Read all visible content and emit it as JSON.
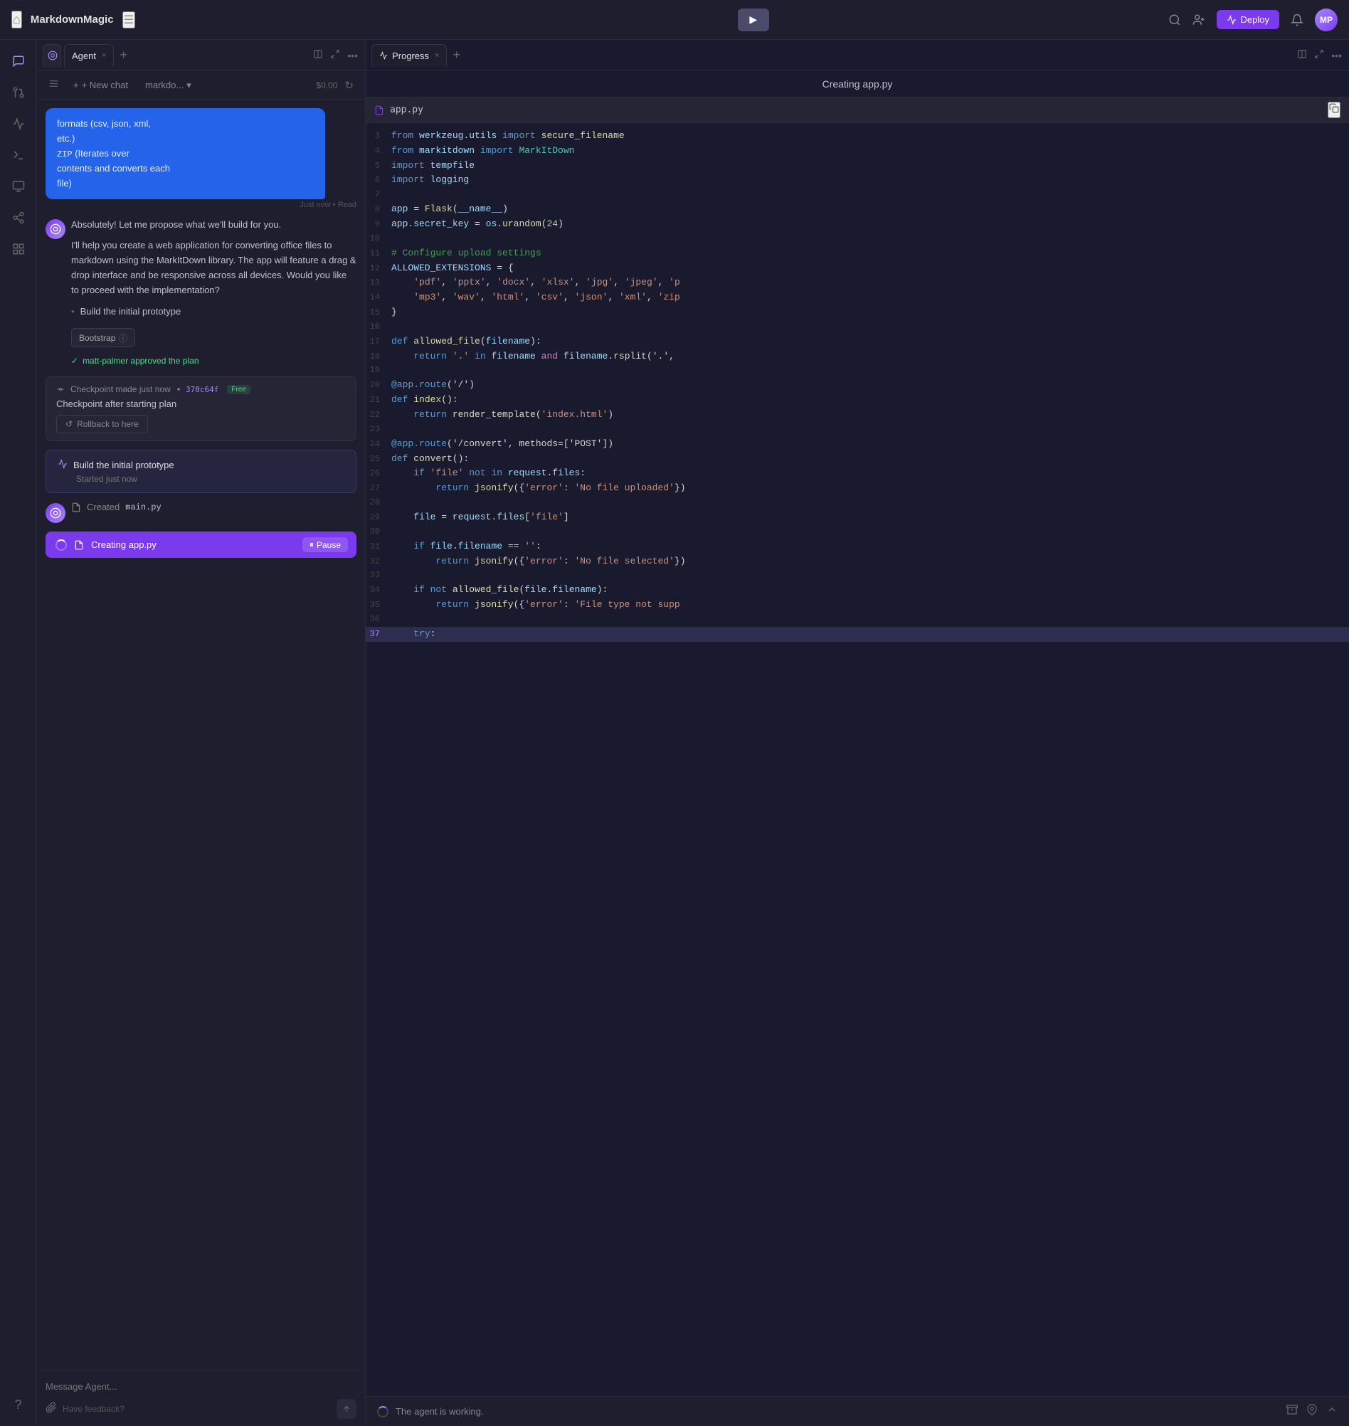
{
  "app": {
    "title": "MarkdownMagic",
    "home_icon": "⌂",
    "layout_icon": "☰"
  },
  "header": {
    "play_label": "▶",
    "deploy_label": "Deploy",
    "search_icon": "🔍",
    "add_user_icon": "👤+",
    "bell_icon": "🔔",
    "avatar_initials": "MP"
  },
  "left_sidebar": {
    "icons": [
      {
        "name": "chat-icon",
        "symbol": "💬",
        "active": true
      },
      {
        "name": "git-icon",
        "symbol": "◉"
      },
      {
        "name": "terminal-icon",
        "symbol": ">_"
      },
      {
        "name": "monitor-icon",
        "symbol": "⬜"
      },
      {
        "name": "branch-icon",
        "symbol": "⎇"
      },
      {
        "name": "grid-icon",
        "symbol": "⊞"
      }
    ],
    "bottom_icon": {
      "name": "help-icon",
      "symbol": "?"
    }
  },
  "agent_panel": {
    "tab_label": "Agent",
    "tab_close": "×",
    "tab_add": "+",
    "new_chat_label": "+ New chat",
    "chat_selector_label": "markdo...",
    "chat_selector_icon": "▾",
    "cost_label": "$0.00",
    "refresh_icon": "↻"
  },
  "progress_panel": {
    "tab_label": "Progress",
    "tab_close": "×",
    "tab_add": "+"
  },
  "messages": [
    {
      "type": "user",
      "content": "formats (csv, json, xml, etc.)\nZIP (Iterates over contents and converts each file)",
      "timestamp": "Just now • Read"
    },
    {
      "type": "agent",
      "content_lines": [
        "Absolutely! Let me propose what we'll build for you.",
        "I'll help you create a web application for converting office files to markdown using the MarkItDown library. The app will feature a drag & drop interface and be responsive across all devices. Would you like to proceed with the implementation?"
      ],
      "plan_item": "Build the initial prototype",
      "badge_label": "Bootstrap",
      "approval": "matt-palmer approved the plan"
    },
    {
      "type": "checkpoint",
      "header": "Checkpoint made just now",
      "hash": "370c64f",
      "free_label": "Free",
      "title": "Checkpoint after starting plan",
      "rollback_label": "Rollback to here"
    },
    {
      "type": "task",
      "title": "Build the initial prototype",
      "subtitle": "Started just now"
    },
    {
      "type": "agent_action",
      "content": "Created main.py",
      "file": "main.py"
    }
  ],
  "progress_bar": {
    "label": "Creating app.py",
    "pause_label": "Pause",
    "pause_icon": "⏸"
  },
  "chat_input": {
    "placeholder": "Message Agent...",
    "feedback_text": "Have feedback?",
    "attach_icon": "📎",
    "send_icon": "↑"
  },
  "editor": {
    "title": "Creating app.py",
    "filename": "app.py",
    "lines": [
      {
        "num": 3,
        "tokens": [
          {
            "t": "kw",
            "v": "from "
          },
          {
            "t": "var",
            "v": "werkzeug.utils "
          },
          {
            "t": "kw",
            "v": "import "
          },
          {
            "t": "fn",
            "v": "secure_filename"
          }
        ]
      },
      {
        "num": 4,
        "tokens": [
          {
            "t": "kw",
            "v": "from "
          },
          {
            "t": "var",
            "v": "markitdown "
          },
          {
            "t": "kw",
            "v": "import "
          },
          {
            "t": "cls",
            "v": "MarkItDown"
          }
        ]
      },
      {
        "num": 5,
        "tokens": [
          {
            "t": "kw",
            "v": "import "
          },
          {
            "t": "var",
            "v": "tempfile"
          }
        ]
      },
      {
        "num": 6,
        "tokens": [
          {
            "t": "kw",
            "v": "import "
          },
          {
            "t": "var",
            "v": "logging"
          }
        ]
      },
      {
        "num": 7,
        "tokens": []
      },
      {
        "num": 8,
        "tokens": [
          {
            "t": "var",
            "v": "app "
          },
          {
            "t": "punc",
            "v": "= "
          },
          {
            "t": "fn",
            "v": "Flask"
          },
          {
            "t": "punc",
            "v": "("
          },
          {
            "t": "var",
            "v": "__name__"
          },
          {
            "t": "punc",
            "v": ")"
          }
        ]
      },
      {
        "num": 9,
        "tokens": [
          {
            "t": "var",
            "v": "app"
          },
          {
            "t": "punc",
            "v": "."
          },
          {
            "t": "var",
            "v": "secret_key "
          },
          {
            "t": "punc",
            "v": "= "
          },
          {
            "t": "var",
            "v": "os"
          },
          {
            "t": "punc",
            "v": "."
          },
          {
            "t": "fn",
            "v": "urandom"
          },
          {
            "t": "punc",
            "v": "("
          },
          {
            "t": "num",
            "v": "24"
          },
          {
            "t": "punc",
            "v": ")"
          }
        ]
      },
      {
        "num": 10,
        "tokens": []
      },
      {
        "num": 11,
        "tokens": [
          {
            "t": "cmt",
            "v": "# Configure upload settings"
          }
        ]
      },
      {
        "num": 12,
        "tokens": [
          {
            "t": "var",
            "v": "ALLOWED_EXTENSIONS "
          },
          {
            "t": "punc",
            "v": "= {"
          }
        ]
      },
      {
        "num": 13,
        "tokens": [
          {
            "t": "code",
            "v": "    "
          },
          {
            "t": "str",
            "v": "'pdf'"
          },
          {
            "t": "punc",
            "v": ", "
          },
          {
            "t": "str",
            "v": "'pptx'"
          },
          {
            "t": "punc",
            "v": ", "
          },
          {
            "t": "str",
            "v": "'docx'"
          },
          {
            "t": "punc",
            "v": ", "
          },
          {
            "t": "str",
            "v": "'xlsx'"
          },
          {
            "t": "punc",
            "v": ", "
          },
          {
            "t": "str",
            "v": "'jpg'"
          },
          {
            "t": "punc",
            "v": ", "
          },
          {
            "t": "str",
            "v": "'jpeg'"
          },
          {
            "t": "punc",
            "v": ", "
          },
          {
            "t": "str",
            "v": "'p"
          }
        ]
      },
      {
        "num": 14,
        "tokens": [
          {
            "t": "code",
            "v": "    "
          },
          {
            "t": "str",
            "v": "'mp3'"
          },
          {
            "t": "punc",
            "v": ", "
          },
          {
            "t": "str",
            "v": "'wav'"
          },
          {
            "t": "punc",
            "v": ", "
          },
          {
            "t": "str",
            "v": "'html'"
          },
          {
            "t": "punc",
            "v": ", "
          },
          {
            "t": "str",
            "v": "'csv'"
          },
          {
            "t": "punc",
            "v": ", "
          },
          {
            "t": "str",
            "v": "'json'"
          },
          {
            "t": "punc",
            "v": ", "
          },
          {
            "t": "str",
            "v": "'xml'"
          },
          {
            "t": "punc",
            "v": ", "
          },
          {
            "t": "str",
            "v": "'zip"
          }
        ]
      },
      {
        "num": 15,
        "tokens": [
          {
            "t": "punc",
            "v": "}"
          }
        ]
      },
      {
        "num": 16,
        "tokens": []
      },
      {
        "num": 17,
        "tokens": [
          {
            "t": "kw",
            "v": "def "
          },
          {
            "t": "fn",
            "v": "allowed_file"
          },
          {
            "t": "punc",
            "v": "("
          },
          {
            "t": "var",
            "v": "filename"
          },
          {
            "t": "punc",
            "v": "):"
          }
        ]
      },
      {
        "num": 18,
        "tokens": [
          {
            "t": "code",
            "v": "    "
          },
          {
            "t": "kw",
            "v": "return "
          },
          {
            "t": "str",
            "v": "'.' "
          },
          {
            "t": "kw",
            "v": "in "
          },
          {
            "t": "var",
            "v": "filename "
          },
          {
            "t": "kw2",
            "v": "and "
          },
          {
            "t": "var",
            "v": "filename"
          },
          {
            "t": "punc",
            "v": "."
          },
          {
            "t": "fn",
            "v": "rsplit"
          },
          {
            "t": "punc",
            "v": "('.', "
          }
        ]
      },
      {
        "num": 19,
        "tokens": []
      },
      {
        "num": 20,
        "tokens": [
          {
            "t": "decorator",
            "v": "@app.route"
          },
          {
            "t": "punc",
            "v": "('/')"
          }
        ]
      },
      {
        "num": 21,
        "tokens": [
          {
            "t": "kw",
            "v": "def "
          },
          {
            "t": "fn",
            "v": "index"
          },
          {
            "t": "punc",
            "v": "():"
          }
        ]
      },
      {
        "num": 22,
        "tokens": [
          {
            "t": "code",
            "v": "    "
          },
          {
            "t": "kw",
            "v": "return "
          },
          {
            "t": "fn",
            "v": "render_template"
          },
          {
            "t": "punc",
            "v": "("
          },
          {
            "t": "str",
            "v": "'index.html'"
          },
          {
            "t": "punc",
            "v": ")"
          }
        ]
      },
      {
        "num": 23,
        "tokens": []
      },
      {
        "num": 24,
        "tokens": [
          {
            "t": "decorator",
            "v": "@app.route"
          },
          {
            "t": "punc",
            "v": "('/convert', methods=['POST'])"
          }
        ]
      },
      {
        "num": 25,
        "tokens": [
          {
            "t": "kw",
            "v": "def "
          },
          {
            "t": "fn",
            "v": "convert"
          },
          {
            "t": "punc",
            "v": "():"
          }
        ]
      },
      {
        "num": 26,
        "tokens": [
          {
            "t": "code",
            "v": "    "
          },
          {
            "t": "kw",
            "v": "if "
          },
          {
            "t": "str",
            "v": "'file' "
          },
          {
            "t": "kw",
            "v": "not in "
          },
          {
            "t": "var",
            "v": "request"
          },
          {
            "t": "punc",
            "v": "."
          },
          {
            "t": "var",
            "v": "files:"
          }
        ]
      },
      {
        "num": 27,
        "tokens": [
          {
            "t": "code",
            "v": "        "
          },
          {
            "t": "kw",
            "v": "return "
          },
          {
            "t": "fn",
            "v": "jsonify"
          },
          {
            "t": "punc",
            "v": "({"
          },
          {
            "t": "str",
            "v": "'error'"
          },
          {
            "t": "punc",
            "v": ": "
          },
          {
            "t": "str",
            "v": "'No file uploaded'"
          },
          {
            "t": "punc",
            "v": "})"
          }
        ]
      },
      {
        "num": 28,
        "tokens": []
      },
      {
        "num": 29,
        "tokens": [
          {
            "t": "code",
            "v": "    "
          },
          {
            "t": "var",
            "v": "file "
          },
          {
            "t": "punc",
            "v": "= "
          },
          {
            "t": "var",
            "v": "request"
          },
          {
            "t": "punc",
            "v": "."
          },
          {
            "t": "var",
            "v": "files"
          },
          {
            "t": "punc",
            "v": "["
          },
          {
            "t": "str",
            "v": "'file'"
          },
          {
            "t": "punc",
            "v": "]"
          }
        ]
      },
      {
        "num": 30,
        "tokens": []
      },
      {
        "num": 31,
        "tokens": [
          {
            "t": "code",
            "v": "    "
          },
          {
            "t": "kw",
            "v": "if "
          },
          {
            "t": "var",
            "v": "file"
          },
          {
            "t": "punc",
            "v": "."
          },
          {
            "t": "var",
            "v": "filename "
          },
          {
            "t": "punc",
            "v": "== "
          },
          {
            "t": "str",
            "v": "''"
          },
          {
            "t": "punc",
            "v": ":"
          }
        ]
      },
      {
        "num": 32,
        "tokens": [
          {
            "t": "code",
            "v": "        "
          },
          {
            "t": "kw",
            "v": "return "
          },
          {
            "t": "fn",
            "v": "jsonify"
          },
          {
            "t": "punc",
            "v": "({"
          },
          {
            "t": "str",
            "v": "'error'"
          },
          {
            "t": "punc",
            "v": ": "
          },
          {
            "t": "str",
            "v": "'No file selected'"
          },
          {
            "t": "punc",
            "v": "})"
          }
        ]
      },
      {
        "num": 33,
        "tokens": []
      },
      {
        "num": 34,
        "tokens": [
          {
            "t": "code",
            "v": "    "
          },
          {
            "t": "kw",
            "v": "if not "
          },
          {
            "t": "fn",
            "v": "allowed_file"
          },
          {
            "t": "punc",
            "v": "("
          },
          {
            "t": "var",
            "v": "file"
          },
          {
            "t": "punc",
            "v": "."
          },
          {
            "t": "var",
            "v": "filename"
          },
          {
            "t": "punc",
            "v": "):"
          }
        ]
      },
      {
        "num": 35,
        "tokens": [
          {
            "t": "code",
            "v": "        "
          },
          {
            "t": "kw",
            "v": "return "
          },
          {
            "t": "fn",
            "v": "jsonify"
          },
          {
            "t": "punc",
            "v": "({"
          },
          {
            "t": "str",
            "v": "'error'"
          },
          {
            "t": "punc",
            "v": ": "
          },
          {
            "t": "str",
            "v": "'File type not supp"
          }
        ]
      },
      {
        "num": 36,
        "tokens": []
      },
      {
        "num": 37,
        "tokens": [
          {
            "t": "code",
            "v": "    "
          },
          {
            "t": "kw",
            "v": "try"
          },
          {
            "t": "punc",
            "v": ":"
          }
        ],
        "highlighted": true
      }
    ]
  },
  "status_bar": {
    "working_text": "The agent is working.",
    "archive_icon": "⊡",
    "pin_icon": "📌",
    "expand_icon": "∧"
  }
}
